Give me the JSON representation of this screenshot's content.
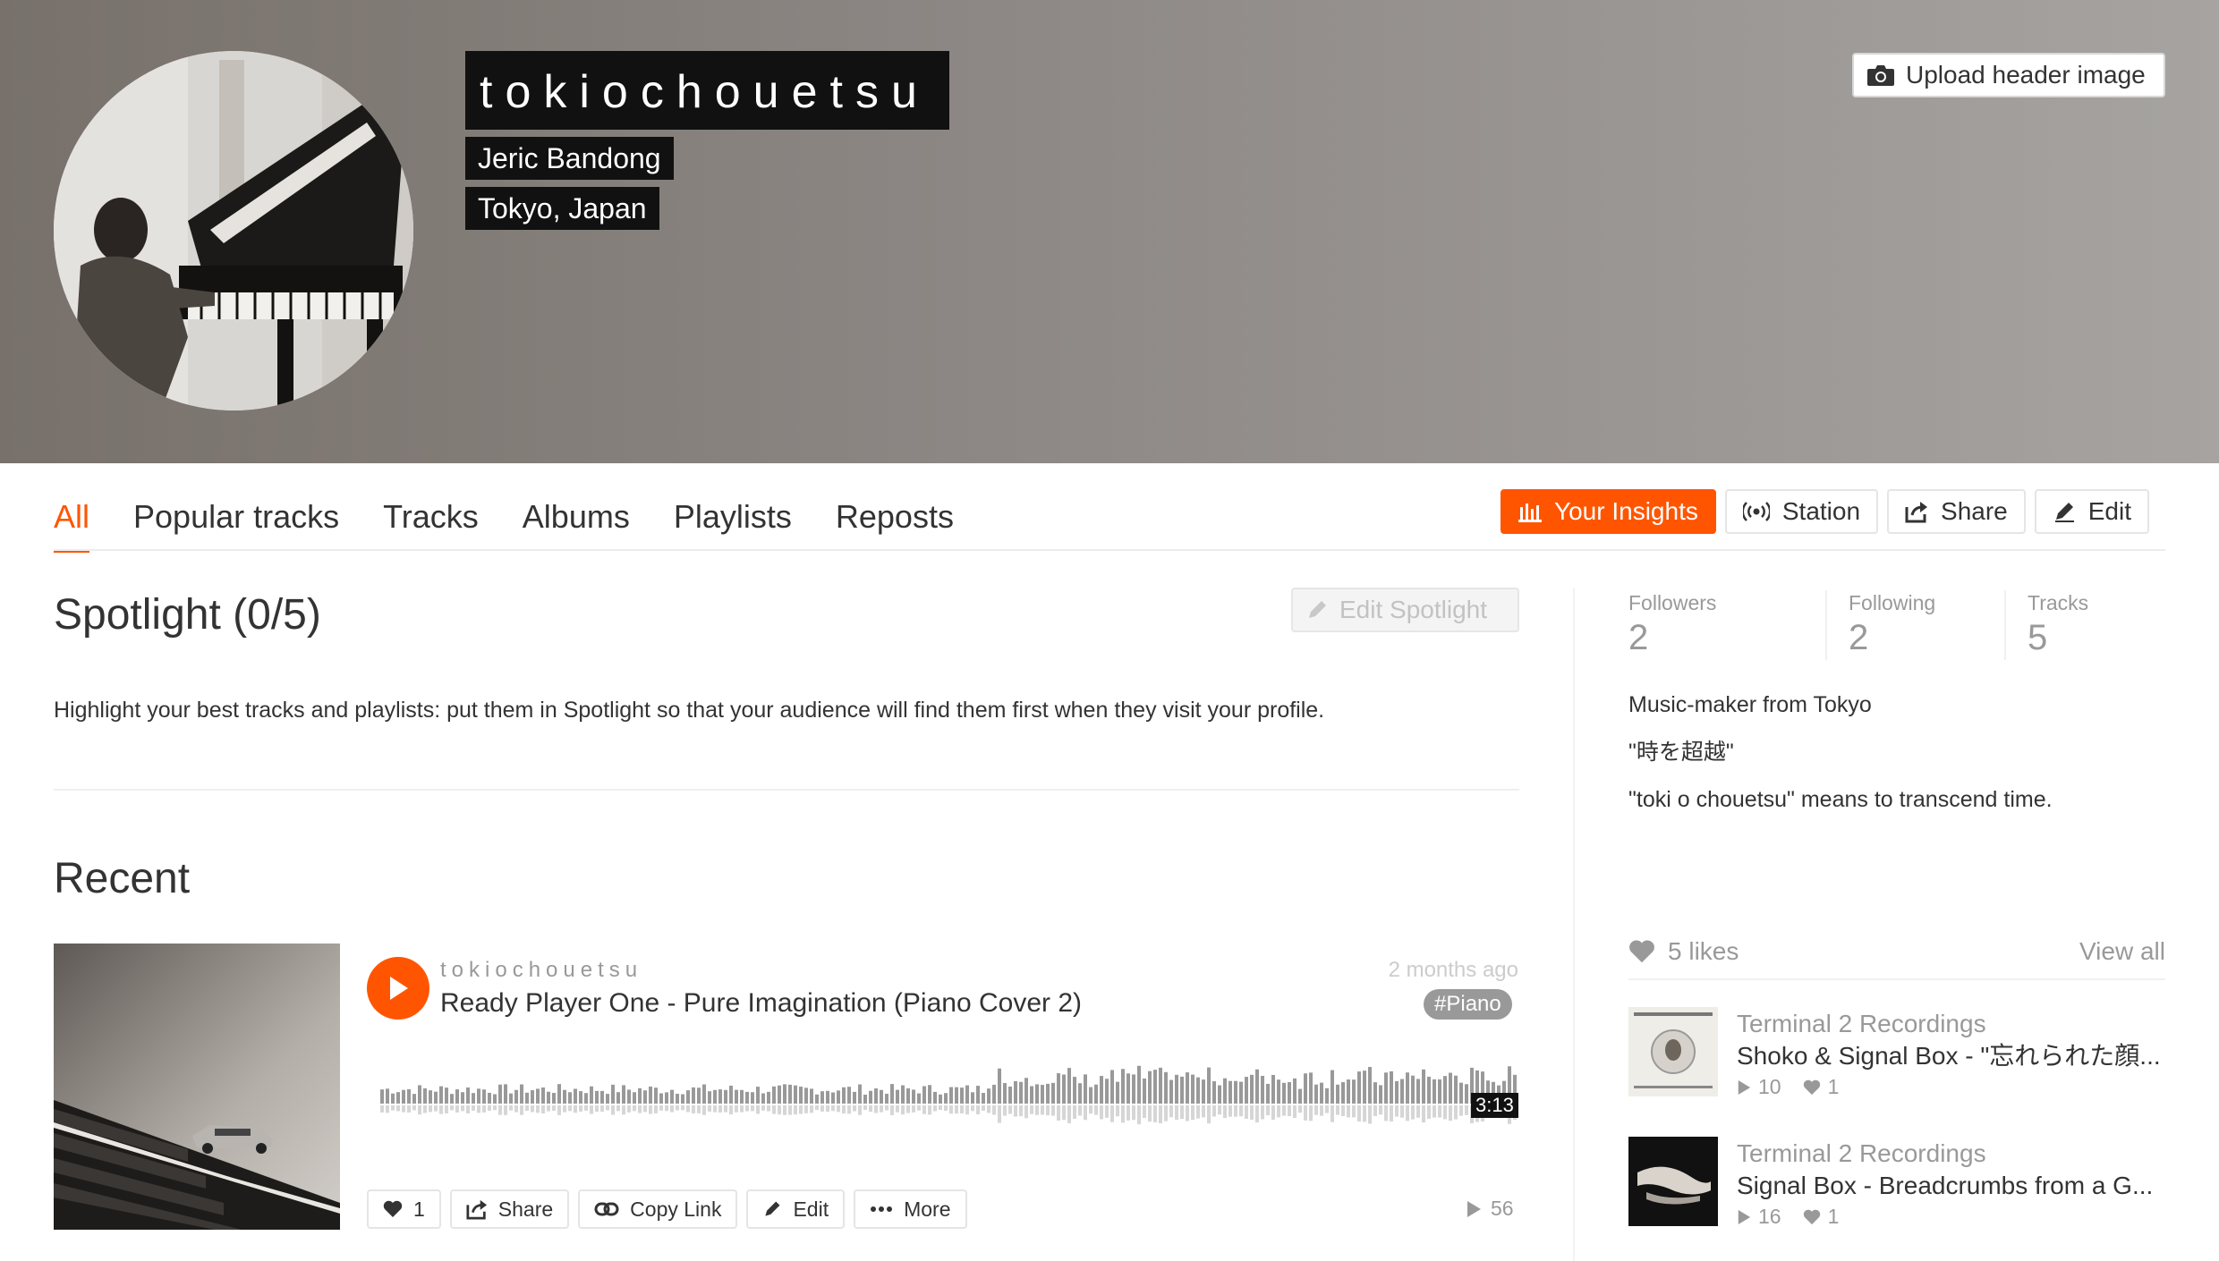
{
  "profile": {
    "username": "tokiochouetsu",
    "full_name": "Jeric Bandong",
    "location": "Tokyo, Japan",
    "upload_header_label": "Upload header image"
  },
  "tabs": [
    {
      "label": "All",
      "active": true
    },
    {
      "label": "Popular tracks",
      "active": false
    },
    {
      "label": "Tracks",
      "active": false
    },
    {
      "label": "Albums",
      "active": false
    },
    {
      "label": "Playlists",
      "active": false
    },
    {
      "label": "Reposts",
      "active": false
    }
  ],
  "actions": {
    "insights": "Your Insights",
    "station": "Station",
    "share": "Share",
    "edit": "Edit"
  },
  "spotlight": {
    "title": "Spotlight (0/5)",
    "edit_label": "Edit Spotlight",
    "description": "Highlight your best tracks and playlists: put them in Spotlight so that your audience will find them first when they visit your profile."
  },
  "recent": {
    "title": "Recent",
    "track": {
      "user": "tokiochouetsu",
      "title": "Ready Player One - Pure Imagination (Piano Cover 2)",
      "date": "2 months ago",
      "tag": "#Piano",
      "duration": "3:13",
      "likes": "1",
      "plays": "56",
      "buttons": {
        "share": "Share",
        "copy_link": "Copy Link",
        "edit": "Edit",
        "more": "More"
      }
    }
  },
  "stats": [
    {
      "label": "Followers",
      "value": "2"
    },
    {
      "label": "Following",
      "value": "2"
    },
    {
      "label": "Tracks",
      "value": "5"
    }
  ],
  "bio": [
    "Music-maker from Tokyo",
    "\"時を超越\"",
    "\"toki o chouetsu\" means to transcend time."
  ],
  "likes": {
    "count_label": "5 likes",
    "view_all": "View all",
    "items": [
      {
        "user": "Terminal 2 Recordings",
        "title": "Shoko & Signal Box - \"忘れられた顔...",
        "plays": "10",
        "likes": "1"
      },
      {
        "user": "Terminal 2 Recordings",
        "title": "Signal Box - Breadcrumbs from a G...",
        "plays": "16",
        "likes": "1"
      }
    ]
  },
  "colors": {
    "accent": "#ff5500",
    "tag_bg": "#999999"
  }
}
